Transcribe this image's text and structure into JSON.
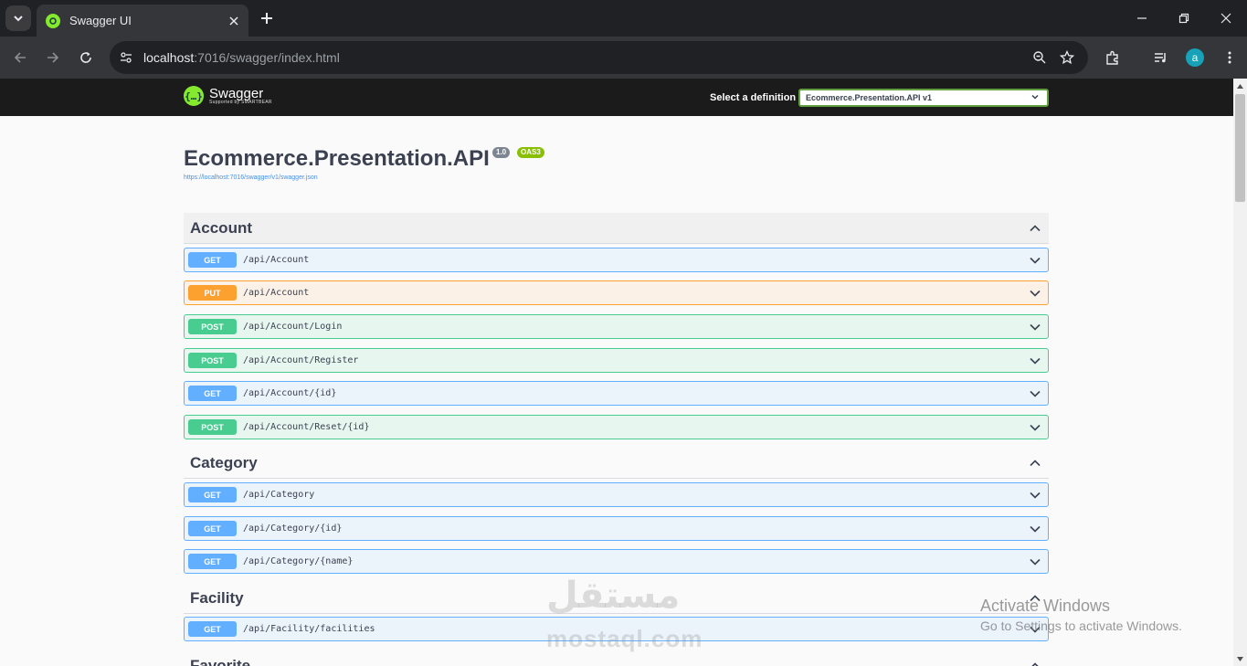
{
  "browser": {
    "tab_title": "Swagger UI",
    "url_host": "localhost",
    "url_rest": ":7016/swagger/index.html",
    "profile_initial": "a"
  },
  "swagger": {
    "logo_text": "Swagger",
    "logo_sub": "Supported by SMARTBEAR",
    "definition_label": "Select a definition",
    "definition_value": "Ecommerce.Presentation.API v1"
  },
  "info": {
    "title": "Ecommerce.Presentation.API",
    "version": "1.0",
    "oas": "OAS3",
    "spec_url": "https://localhost:7016/swagger/v1/swagger.json"
  },
  "tags": [
    {
      "name": "Account",
      "operations": [
        {
          "method": "GET",
          "path": "/api/Account"
        },
        {
          "method": "PUT",
          "path": "/api/Account"
        },
        {
          "method": "POST",
          "path": "/api/Account/Login"
        },
        {
          "method": "POST",
          "path": "/api/Account/Register"
        },
        {
          "method": "GET",
          "path": "/api/Account/{id}"
        },
        {
          "method": "POST",
          "path": "/api/Account/Reset/{id}"
        }
      ]
    },
    {
      "name": "Category",
      "operations": [
        {
          "method": "GET",
          "path": "/api/Category"
        },
        {
          "method": "GET",
          "path": "/api/Category/{id}"
        },
        {
          "method": "GET",
          "path": "/api/Category/{name}"
        }
      ]
    },
    {
      "name": "Facility",
      "operations": [
        {
          "method": "GET",
          "path": "/api/Facility/facilities"
        }
      ]
    },
    {
      "name": "Favorite",
      "operations": []
    }
  ],
  "watermark": {
    "logo": "مستقل",
    "site": "mostaql.com"
  },
  "activation": {
    "line1": "Activate Windows",
    "line2": "Go to Settings to activate Windows."
  },
  "colors": {
    "get": "#61affe",
    "put": "#fca130",
    "post": "#49cc90",
    "swagger_green": "#85ea2d"
  }
}
